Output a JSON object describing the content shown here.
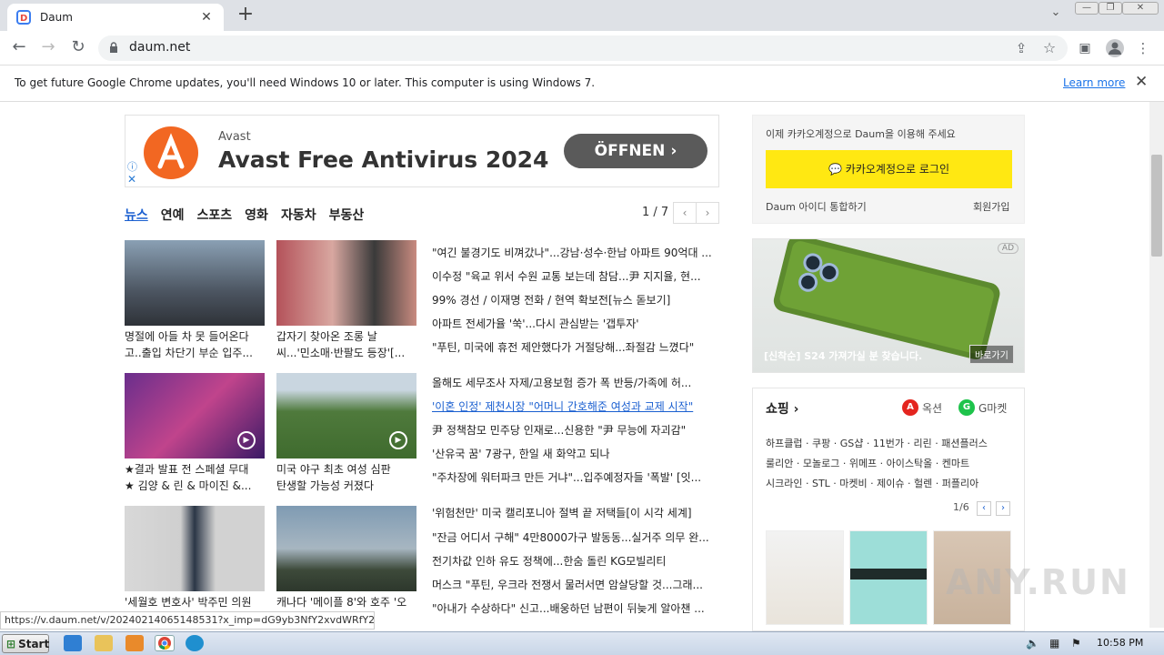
{
  "browser": {
    "tab_title": "Daum",
    "url": "daum.net",
    "infobar_text": "To get future Google Chrome updates, you'll need Windows 10 or later. This computer is using Windows 7.",
    "learn_more": "Learn more"
  },
  "ad": {
    "brand": "Avast",
    "title": "Avast Free Antivirus 2024",
    "cta": "ÖFFNEN"
  },
  "news": {
    "tabs": [
      "뉴스",
      "연예",
      "스포츠",
      "영화",
      "자동차",
      "부동산"
    ],
    "page": "1 / 7",
    "cards": [
      {
        "caption1": "명절에 아들 차 못 들어온다",
        "caption2": "고..출입 차단기 부순 입주..."
      },
      {
        "caption1": "갑자기 찾아온 조롱 날",
        "caption2": "씨...'민소매·반팔도 등장'[..."
      },
      {
        "caption1": "★결과 발표 전 스페셜 무대",
        "caption2": "★ 김양 & 린 & 마이진 &..."
      },
      {
        "caption1": "미국 야구 최초 여성 심판",
        "caption2": "탄생할 가능성 커졌다"
      },
      {
        "caption1": "'세월호 변호사' 박주민 의원",
        "caption2": ""
      },
      {
        "caption1": "캐나다 '메이플 8'와 호주 '오",
        "caption2": ""
      }
    ],
    "headlines": [
      "\"여긴 불경기도 비껴갔나\"...강남·성수·한남 아파트 90억대 ...",
      "이수정 \"육교 위서 수원 교통 보는데 참담...尹 지지율, 현...",
      "99% 경선 / 이재명 전화 / 현역 확보전[뉴스 돋보기]",
      "아파트 전세가율 '쑥'...다시 관심받는 '갭투자'",
      "\"푸틴, 미국에 휴전 제안했다가 거절당해...좌절감 느꼈다\"",
      "올해도 세무조사 자제/고용보험 증가 폭 반등/가족에 허...",
      "'이혼 인정' 제천시장 \"어머니 간호해준 여성과 교제 시작\"",
      "尹 정책참모 민주당 인재로...신용한 \"尹 무능에 자괴감\"",
      "'산유국 꿈' 7광구, 한일 새 화약고 되나",
      "\"주차장에 워터파크 만든 거냐\"...입주예정자들 '폭발' [잇...",
      "'위험천만' 미국 캘리포니아 절벽 끝 저택들[이 시각 세계]",
      "\"잔금 어디서 구해\" 4만8000가구 발동동...실거주 의무 완...",
      "전기차값 인하 유도 정책에...한숨 돌린 KG모빌리티",
      "머스크 \"푸틴, 우크라 전쟁서 물러서면 암살당할 것...그래...",
      "\"아내가 수상하다\" 신고...배웅하던 남편이 뒤늦게 알아챈 ..."
    ]
  },
  "login": {
    "message": "이제 카카오계정으로 Daum을 이용해 주세요",
    "kakao_button": "카카오계정으로 로그인",
    "daum_id": "Daum 아이디 통합하기",
    "join": "회원가입"
  },
  "promo": {
    "ad_tag": "AD",
    "text": "[신착순] S24 가져가실 분 찾습니다.",
    "go": "바로가기"
  },
  "shopping": {
    "title": "쇼핑",
    "mall1": "옥션",
    "mall2": "G마켓",
    "row1": "하프클럽 · 쿠팡 · GS샵 · 11번가 · 리린 · 패션플러스",
    "row2": "룰리안 · 모놀로그 · 위메프 · 아이스탁올 · 켄마트",
    "row3": "시크라인 · STL · 마켓비 · 제이슈 · 헐렌 · 퍼플리아",
    "page": "1/6"
  },
  "status_url": "https://v.daum.net/v/20240214065148531?x_imp=dG9yb3NfY2xvdWRfY2F...",
  "taskbar": {
    "start": "Start",
    "clock": "10:58 PM"
  },
  "watermark": "ANY.RUN"
}
